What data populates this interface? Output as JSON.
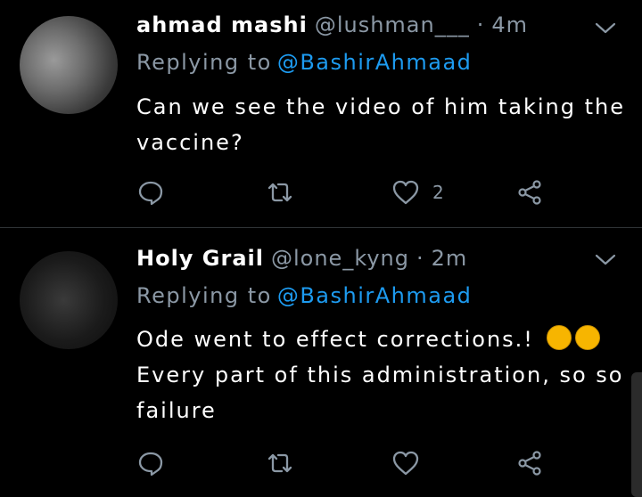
{
  "tweets": [
    {
      "display_name": "ahmad mashi",
      "handle": "@lushman___",
      "separator": "·",
      "time": "4m",
      "replying_prefix": "Replying to",
      "replying_to": "@BashirAhmaad",
      "text": "Can we see the video of him taking the vaccine?",
      "like_count": "2"
    },
    {
      "display_name": "Holy Grail",
      "handle": "@lone_kyng",
      "separator": "·",
      "time": "2m",
      "replying_prefix": "Replying to",
      "replying_to": "@BashirAhmaad",
      "text_line1": "Ode went to effect corrections.!",
      "text_rest": "Every part of this administration, so so failure",
      "like_count": ""
    }
  ],
  "icons": {
    "reply": "reply-icon",
    "retweet": "retweet-icon",
    "like": "heart-icon",
    "share": "share-icon",
    "menu": "chevron-down-icon",
    "emoji": "rolling-on-floor-laughing-emoji"
  },
  "colors": {
    "background": "#000000",
    "text": "#ffffff",
    "muted": "#8b98a5",
    "link": "#1d9bf0"
  }
}
